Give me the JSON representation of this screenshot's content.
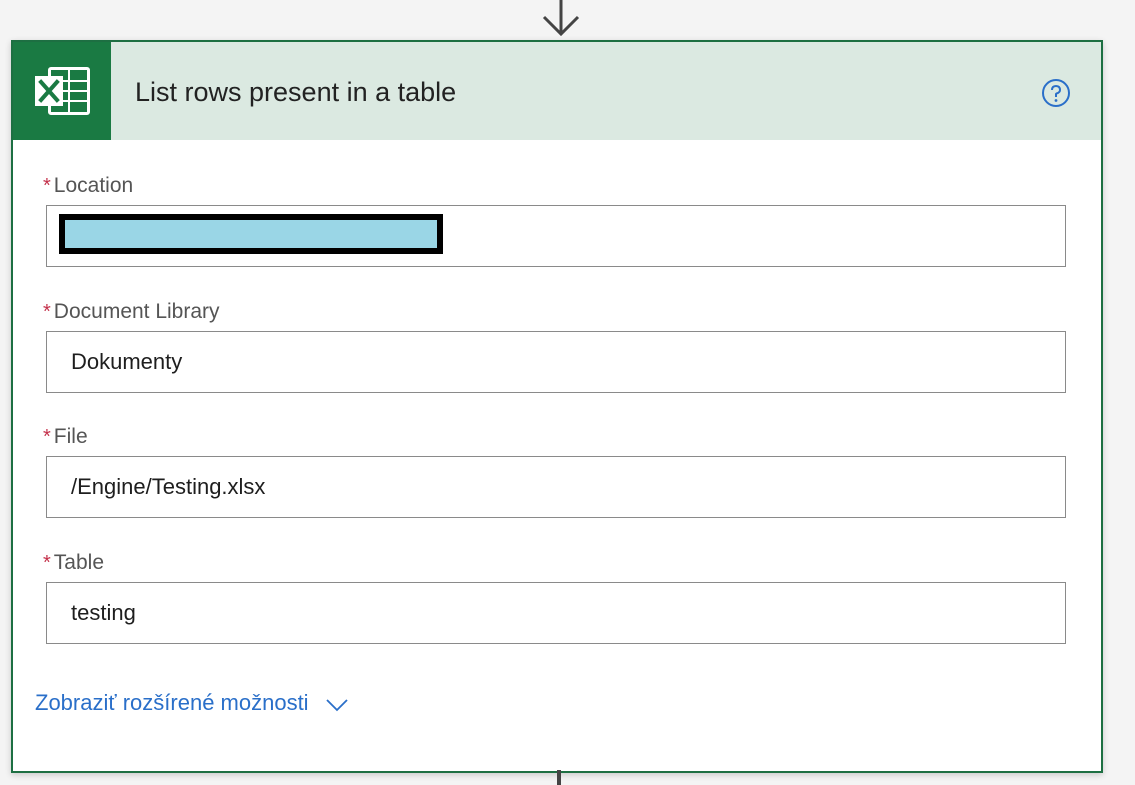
{
  "action": {
    "title": "List rows present in a table",
    "icon": "excel-icon",
    "help_icon": "help-question-icon"
  },
  "colors": {
    "brand": "#1a7a43",
    "header_bg": "#dbe9e1",
    "required": "#c4314b",
    "link": "#2a6fc9"
  },
  "fields": [
    {
      "required_mark": "*",
      "label": "Location",
      "value": ""
    },
    {
      "required_mark": "*",
      "label": "Document Library",
      "value": "Dokumenty"
    },
    {
      "required_mark": "*",
      "label": "File",
      "value": "/Engine/Testing.xlsx"
    },
    {
      "required_mark": "*",
      "label": "Table",
      "value": "testing"
    }
  ],
  "advanced_options": {
    "label": "Zobraziť rozšírené možnosti",
    "icon": "chevron-down-icon"
  }
}
